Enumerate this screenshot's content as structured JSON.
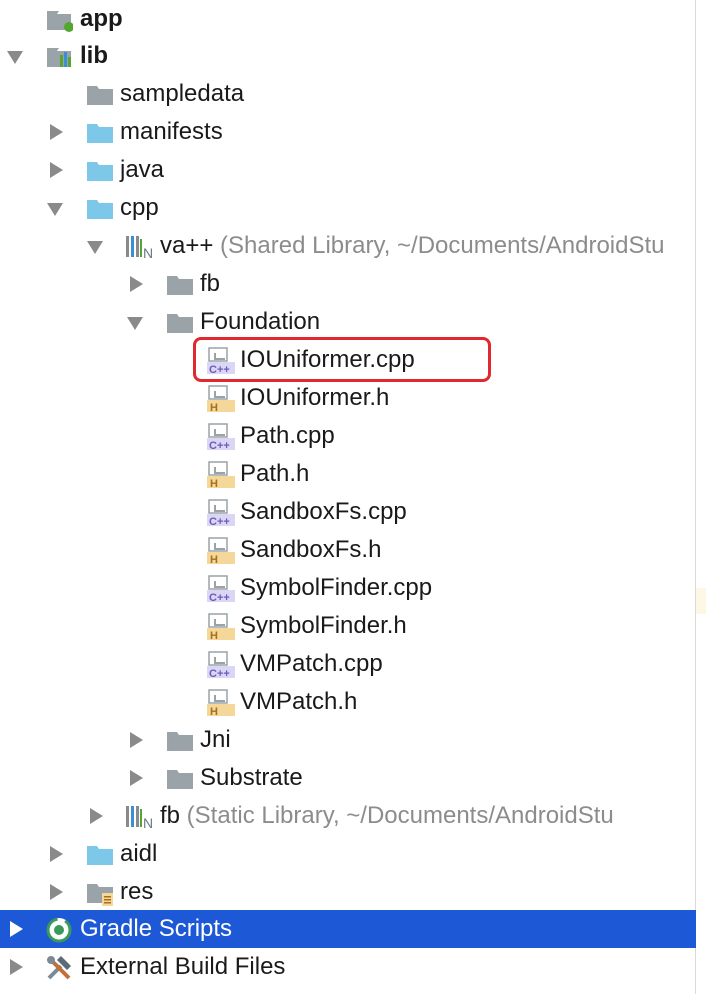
{
  "tree": {
    "app": {
      "label": "app"
    },
    "lib": {
      "label": "lib"
    },
    "sampledata": {
      "label": "sampledata"
    },
    "manifests": {
      "label": "manifests"
    },
    "java": {
      "label": "java"
    },
    "cpp": {
      "label": "cpp"
    },
    "va_lib": {
      "label": "va++",
      "suffix": " (Shared Library, ~/Documents/AndroidStu"
    },
    "fb_folder": {
      "label": "fb"
    },
    "foundation": {
      "label": "Foundation"
    },
    "files": [
      {
        "label": "IOUniformer.cpp",
        "type": "C++"
      },
      {
        "label": "IOUniformer.h",
        "type": "H"
      },
      {
        "label": "Path.cpp",
        "type": "C++"
      },
      {
        "label": "Path.h",
        "type": "H"
      },
      {
        "label": "SandboxFs.cpp",
        "type": "C++"
      },
      {
        "label": "SandboxFs.h",
        "type": "H"
      },
      {
        "label": "SymbolFinder.cpp",
        "type": "C++"
      },
      {
        "label": "SymbolFinder.h",
        "type": "H"
      },
      {
        "label": "VMPatch.cpp",
        "type": "C++"
      },
      {
        "label": "VMPatch.h",
        "type": "H"
      }
    ],
    "jni": {
      "label": "Jni"
    },
    "substrate": {
      "label": "Substrate"
    },
    "fb_lib": {
      "label": "fb",
      "suffix": " (Static Library, ~/Documents/AndroidStu"
    },
    "aidl": {
      "label": "aidl"
    },
    "res": {
      "label": "res"
    },
    "gradle_scripts": {
      "label": "Gradle Scripts"
    },
    "external_build_files": {
      "label": "External Build Files"
    }
  },
  "icons": {
    "folder_blue": "#7dc8e8",
    "folder_gray": "#9aa3a8",
    "cpp_badge": "#8f7fd1",
    "h_badge": "#f0c070",
    "selection": "#1d59d6",
    "highlight_box": "#e0282e"
  }
}
